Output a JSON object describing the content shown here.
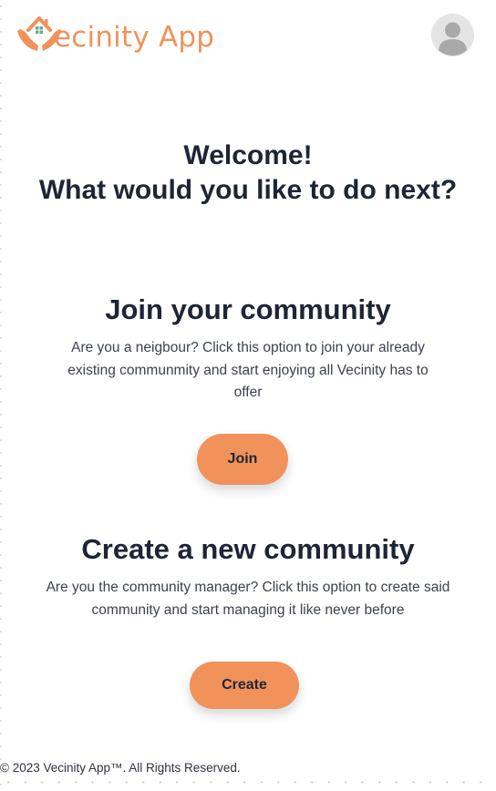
{
  "header": {
    "logo_text": "ecinity App",
    "logo_icon": "house-in-hands-icon",
    "avatar_icon": "user-avatar-icon"
  },
  "welcome": {
    "line1": "Welcome!",
    "line2": "What would you like to do next?"
  },
  "join": {
    "title": "Join your community",
    "description": "Are you a neigbour? Click this option to join your already existing communmity and start enjoying all Vecinity has to offer",
    "button_label": "Join"
  },
  "create": {
    "title": "Create a new community",
    "description": "Are you the community manager? Click this option to create said community and start managing it like never before",
    "button_label": "Create"
  },
  "footer": {
    "copyright": "© 2023 Vecinity App™. All Rights Reserved."
  },
  "colors": {
    "accent": "#f0925a",
    "text": "#1e2535",
    "avatar_bg": "#e4e4e4"
  }
}
